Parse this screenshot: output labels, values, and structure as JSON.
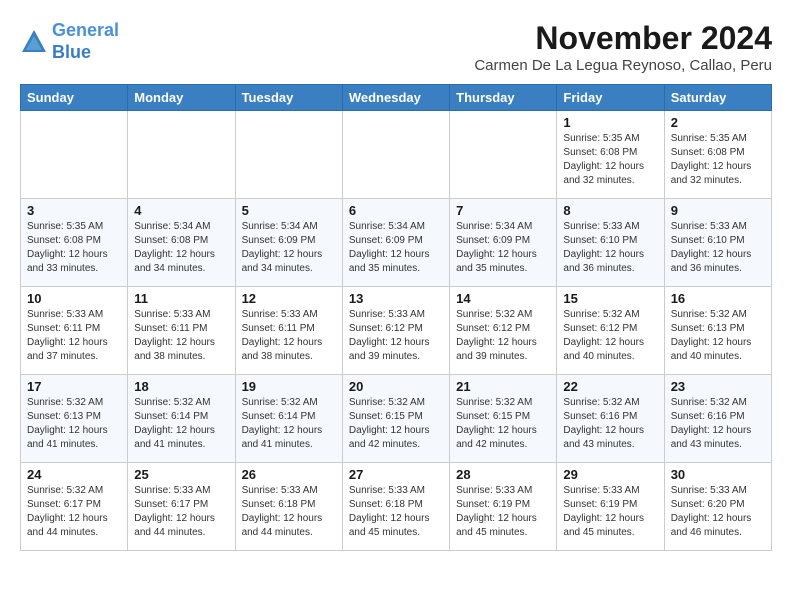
{
  "header": {
    "logo_line1": "General",
    "logo_line2": "Blue",
    "month": "November 2024",
    "location": "Carmen De La Legua Reynoso, Callao, Peru"
  },
  "weekdays": [
    "Sunday",
    "Monday",
    "Tuesday",
    "Wednesday",
    "Thursday",
    "Friday",
    "Saturday"
  ],
  "weeks": [
    [
      {
        "day": "",
        "info": ""
      },
      {
        "day": "",
        "info": ""
      },
      {
        "day": "",
        "info": ""
      },
      {
        "day": "",
        "info": ""
      },
      {
        "day": "",
        "info": ""
      },
      {
        "day": "1",
        "info": "Sunrise: 5:35 AM\nSunset: 6:08 PM\nDaylight: 12 hours\nand 32 minutes."
      },
      {
        "day": "2",
        "info": "Sunrise: 5:35 AM\nSunset: 6:08 PM\nDaylight: 12 hours\nand 32 minutes."
      }
    ],
    [
      {
        "day": "3",
        "info": "Sunrise: 5:35 AM\nSunset: 6:08 PM\nDaylight: 12 hours\nand 33 minutes."
      },
      {
        "day": "4",
        "info": "Sunrise: 5:34 AM\nSunset: 6:08 PM\nDaylight: 12 hours\nand 34 minutes."
      },
      {
        "day": "5",
        "info": "Sunrise: 5:34 AM\nSunset: 6:09 PM\nDaylight: 12 hours\nand 34 minutes."
      },
      {
        "day": "6",
        "info": "Sunrise: 5:34 AM\nSunset: 6:09 PM\nDaylight: 12 hours\nand 35 minutes."
      },
      {
        "day": "7",
        "info": "Sunrise: 5:34 AM\nSunset: 6:09 PM\nDaylight: 12 hours\nand 35 minutes."
      },
      {
        "day": "8",
        "info": "Sunrise: 5:33 AM\nSunset: 6:10 PM\nDaylight: 12 hours\nand 36 minutes."
      },
      {
        "day": "9",
        "info": "Sunrise: 5:33 AM\nSunset: 6:10 PM\nDaylight: 12 hours\nand 36 minutes."
      }
    ],
    [
      {
        "day": "10",
        "info": "Sunrise: 5:33 AM\nSunset: 6:11 PM\nDaylight: 12 hours\nand 37 minutes."
      },
      {
        "day": "11",
        "info": "Sunrise: 5:33 AM\nSunset: 6:11 PM\nDaylight: 12 hours\nand 38 minutes."
      },
      {
        "day": "12",
        "info": "Sunrise: 5:33 AM\nSunset: 6:11 PM\nDaylight: 12 hours\nand 38 minutes."
      },
      {
        "day": "13",
        "info": "Sunrise: 5:33 AM\nSunset: 6:12 PM\nDaylight: 12 hours\nand 39 minutes."
      },
      {
        "day": "14",
        "info": "Sunrise: 5:32 AM\nSunset: 6:12 PM\nDaylight: 12 hours\nand 39 minutes."
      },
      {
        "day": "15",
        "info": "Sunrise: 5:32 AM\nSunset: 6:12 PM\nDaylight: 12 hours\nand 40 minutes."
      },
      {
        "day": "16",
        "info": "Sunrise: 5:32 AM\nSunset: 6:13 PM\nDaylight: 12 hours\nand 40 minutes."
      }
    ],
    [
      {
        "day": "17",
        "info": "Sunrise: 5:32 AM\nSunset: 6:13 PM\nDaylight: 12 hours\nand 41 minutes."
      },
      {
        "day": "18",
        "info": "Sunrise: 5:32 AM\nSunset: 6:14 PM\nDaylight: 12 hours\nand 41 minutes."
      },
      {
        "day": "19",
        "info": "Sunrise: 5:32 AM\nSunset: 6:14 PM\nDaylight: 12 hours\nand 41 minutes."
      },
      {
        "day": "20",
        "info": "Sunrise: 5:32 AM\nSunset: 6:15 PM\nDaylight: 12 hours\nand 42 minutes."
      },
      {
        "day": "21",
        "info": "Sunrise: 5:32 AM\nSunset: 6:15 PM\nDaylight: 12 hours\nand 42 minutes."
      },
      {
        "day": "22",
        "info": "Sunrise: 5:32 AM\nSunset: 6:16 PM\nDaylight: 12 hours\nand 43 minutes."
      },
      {
        "day": "23",
        "info": "Sunrise: 5:32 AM\nSunset: 6:16 PM\nDaylight: 12 hours\nand 43 minutes."
      }
    ],
    [
      {
        "day": "24",
        "info": "Sunrise: 5:32 AM\nSunset: 6:17 PM\nDaylight: 12 hours\nand 44 minutes."
      },
      {
        "day": "25",
        "info": "Sunrise: 5:33 AM\nSunset: 6:17 PM\nDaylight: 12 hours\nand 44 minutes."
      },
      {
        "day": "26",
        "info": "Sunrise: 5:33 AM\nSunset: 6:18 PM\nDaylight: 12 hours\nand 44 minutes."
      },
      {
        "day": "27",
        "info": "Sunrise: 5:33 AM\nSunset: 6:18 PM\nDaylight: 12 hours\nand 45 minutes."
      },
      {
        "day": "28",
        "info": "Sunrise: 5:33 AM\nSunset: 6:19 PM\nDaylight: 12 hours\nand 45 minutes."
      },
      {
        "day": "29",
        "info": "Sunrise: 5:33 AM\nSunset: 6:19 PM\nDaylight: 12 hours\nand 45 minutes."
      },
      {
        "day": "30",
        "info": "Sunrise: 5:33 AM\nSunset: 6:20 PM\nDaylight: 12 hours\nand 46 minutes."
      }
    ]
  ]
}
